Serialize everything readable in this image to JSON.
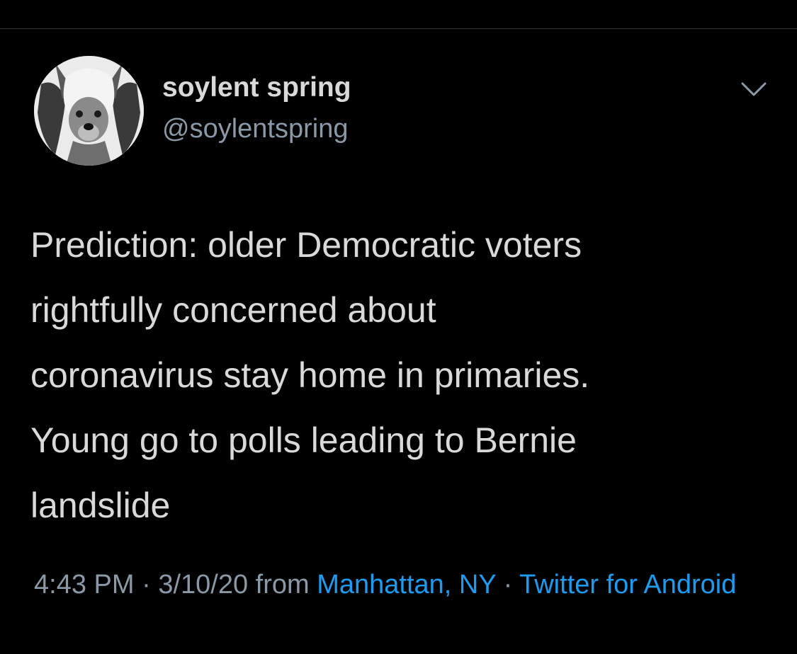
{
  "author": {
    "display_name": "soylent spring",
    "handle": "@soylentspring",
    "avatar_icon": "hairless-dog-avatar"
  },
  "more_menu_icon": "chevron-down-icon",
  "tweet": {
    "text": "Prediction: older Democratic voters\nrightfully concerned about\ncoronavirus stay home in primaries.\nYoung go to polls leading to Bernie\nlandslide"
  },
  "meta": {
    "time": "4:43 PM",
    "separator_1": " · ",
    "date": "3/10/20",
    "from_label": " from ",
    "location": "Manhattan, NY",
    "separator_2": " · ",
    "source": "Twitter for Android"
  },
  "colors": {
    "background": "#000000",
    "primary_text": "#d9d9d9",
    "secondary_text": "#8b98a5",
    "link": "#1d9bf0"
  }
}
